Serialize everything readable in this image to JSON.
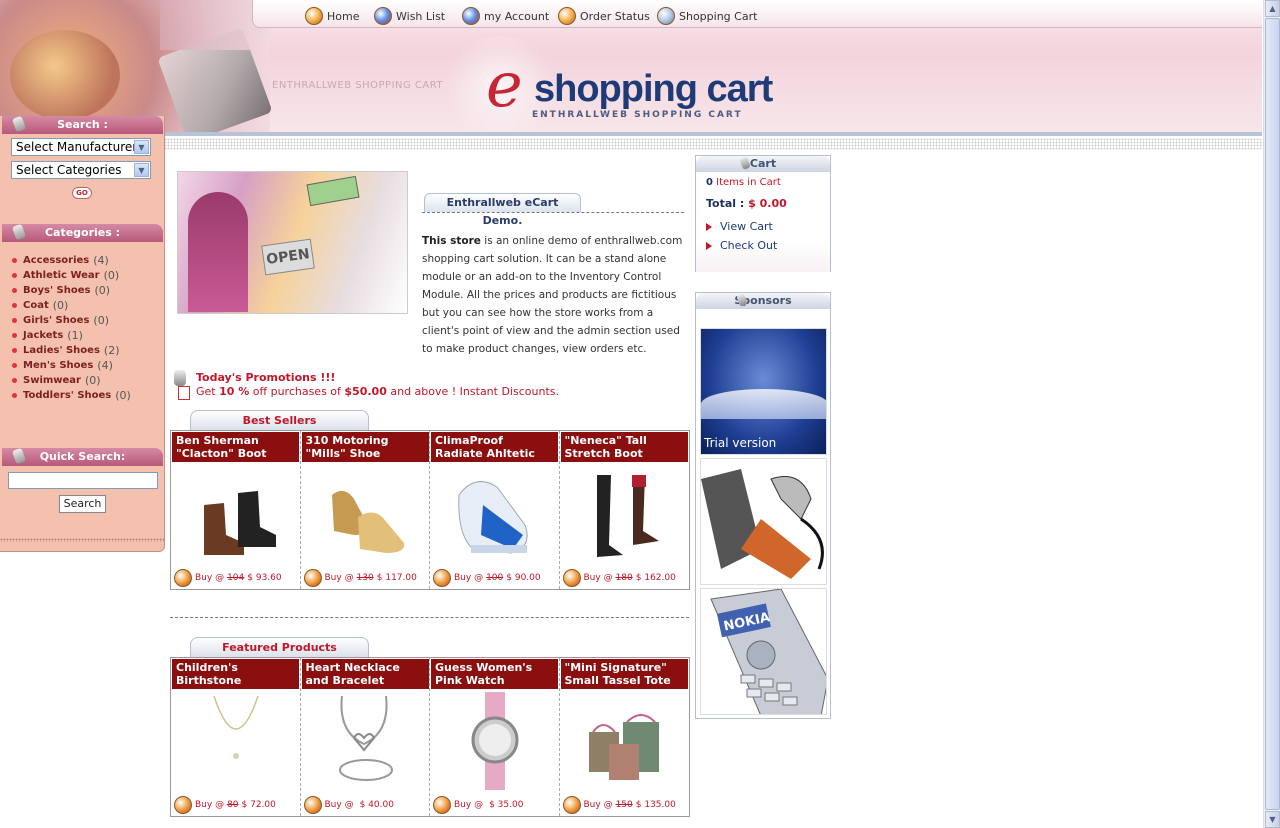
{
  "nav": {
    "home": "Home",
    "wishlist": "Wish List",
    "account": "my Account",
    "order_status": "Order Status",
    "cart": "Shopping Cart"
  },
  "header": {
    "brand_tag": "ENTHRALLWEB SHOPPING CART",
    "logo_e": "e",
    "logo_word": "shopping cart",
    "logo_sub": "ENTHRALLWEB SHOPPING CART"
  },
  "sidebar": {
    "search_title": "Search :",
    "manufacturer_select": "Select Manufacturer",
    "category_select": "Select Categories",
    "go_label": "GO",
    "categories_title": "Categories :",
    "categories": [
      {
        "name": "Accessories",
        "count": "(4)"
      },
      {
        "name": "Athletic Wear",
        "count": "(0)"
      },
      {
        "name": "Boys' Shoes",
        "count": "(0)"
      },
      {
        "name": "Coat",
        "count": "(0)"
      },
      {
        "name": "Girls' Shoes",
        "count": "(0)"
      },
      {
        "name": "Jackets",
        "count": "(1)"
      },
      {
        "name": "Ladies' Shoes",
        "count": "(2)"
      },
      {
        "name": "Men's Shoes",
        "count": "(4)"
      },
      {
        "name": "Swimwear",
        "count": "(0)"
      },
      {
        "name": "Toddlers' Shoes",
        "count": "(0)"
      }
    ],
    "quick_search_title": "Quick Search:",
    "quick_search_value": "",
    "quick_search_button": "Search"
  },
  "main": {
    "demo_title": "Enthrallweb eCart Demo.",
    "demo_lead": "This store",
    "demo_body": " is an online demo of enthrallweb.com shopping cart solution. It can be a stand alone module or an add-on to the Inventory Control Module.  All the prices and products are fictitious but you can see how the store works from a client's point of view and the admin section used to make product changes, view orders etc.",
    "promo_title": "Today's Promotions !!!",
    "promo_pre": "Get ",
    "promo_pct": "10 %",
    "promo_mid": " off purchases of ",
    "promo_amt": "$50.00",
    "promo_post": "  and above ! Instant Discounts.",
    "best_sellers_title": "Best Sellers",
    "best_sellers": [
      {
        "title": "Ben Sherman \"Clacton\" Boot",
        "buy": "Buy @",
        "old": "104",
        "price": "$ 93.60"
      },
      {
        "title": "310 Motoring \"Mills\" Shoe",
        "buy": "Buy @",
        "old": "130",
        "price": "$ 117.00"
      },
      {
        "title": "ClimaProof Radiate Ahltetic Shoe",
        "buy": "Buy @",
        "old": "100",
        "price": "$ 90.00"
      },
      {
        "title": "\"Neneca\" Tall Stretch Boot",
        "buy": "Buy @",
        "old": "180",
        "price": "$ 162.00"
      }
    ],
    "featured_title": "Featured Products",
    "featured": [
      {
        "title": "Children's Birthstone Necklaces",
        "buy": "Buy @",
        "old": "80",
        "price": "$ 72.00"
      },
      {
        "title": "Heart Necklace and Bracelet",
        "buy": "Buy @",
        "old": "",
        "price": "$ 40.00"
      },
      {
        "title": "Guess Women's Pink Watch",
        "buy": "Buy @",
        "old": "",
        "price": "$ 35.00"
      },
      {
        "title": "\"Mini Signature\" Small Tassel Tote",
        "buy": "Buy @",
        "old": "150",
        "price": "$ 135.00"
      }
    ]
  },
  "cart": {
    "title": "Cart",
    "items_count": "0",
    "items_label": "Items in Cart",
    "total_label": "Total :",
    "total_value": "$ 0.00",
    "view_cart": "View Cart",
    "check_out": "Check Out"
  },
  "sponsors": {
    "title": "Sponsors",
    "trial_label": "Trial version",
    "phone_brand": "NOKIA"
  }
}
